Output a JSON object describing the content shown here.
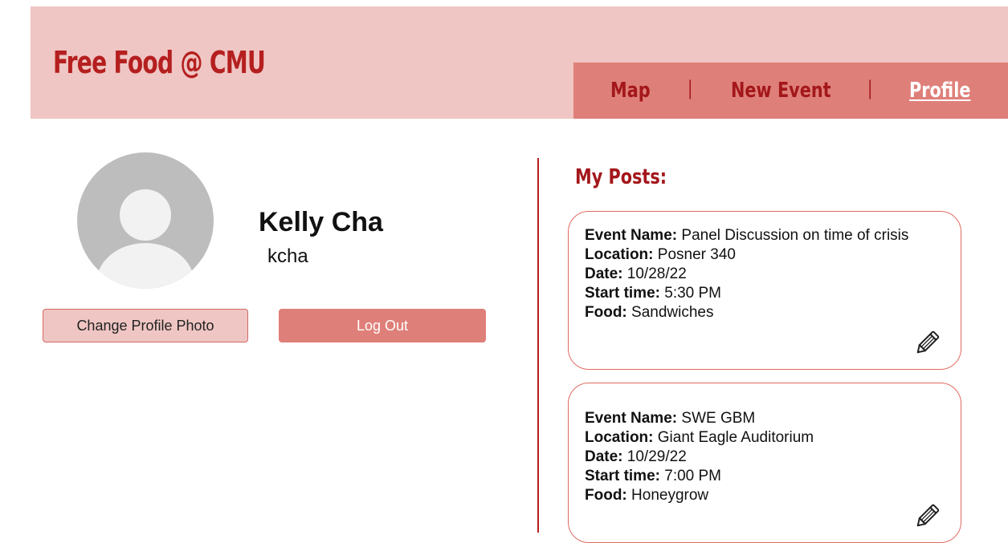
{
  "header": {
    "brand": "Free Food @ CMU",
    "nav": {
      "map": "Map",
      "separator": "|",
      "new_event": "New Event",
      "profile": "Profile"
    }
  },
  "profile": {
    "name": "Kelly Cha",
    "username": "kcha",
    "avatar_icon": "default-user-icon",
    "change_photo_label": "Change Profile Photo",
    "logout_label": "Log Out"
  },
  "posts": {
    "heading": "My Posts:",
    "labels": {
      "event_name": "Event Name:",
      "location": "Location:",
      "date": "Date:",
      "start_time": "Start time:",
      "food": "Food:"
    },
    "items": [
      {
        "event_name": "Panel Discussion on time of crisis",
        "location": "Posner 340",
        "date": "10/28/22",
        "start_time": "5:30 PM",
        "food": "Sandwiches",
        "edit_icon": "pencil-icon"
      },
      {
        "event_name": "SWE GBM",
        "location": "Giant Eagle Auditorium",
        "date": "10/29/22",
        "start_time": "7:00 PM",
        "food": "Honeygrow",
        "edit_icon": "pencil-icon"
      }
    ]
  },
  "colors": {
    "header_bg": "#efc6c3",
    "nav_bg": "#df7f79",
    "brand_red": "#b51f1f",
    "card_border": "#e06a62"
  }
}
